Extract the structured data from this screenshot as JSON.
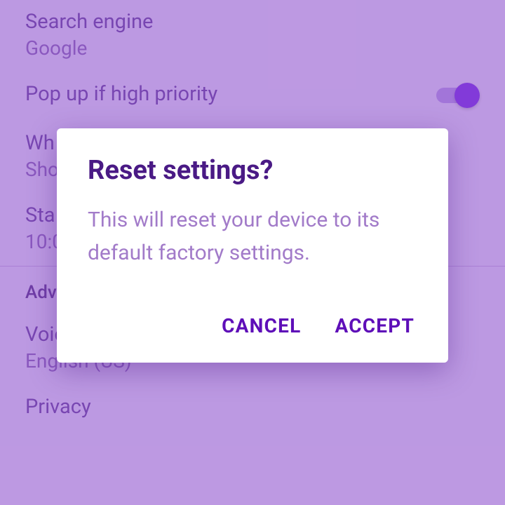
{
  "settings": {
    "search_engine": {
      "title": "Search engine",
      "value": "Google"
    },
    "pop_up": {
      "title": "Pop up if high priority",
      "enabled": true
    },
    "where": {
      "title": "Wh",
      "value": "Sho"
    },
    "start": {
      "title": "Sta",
      "value": "10:0"
    },
    "voice_search": {
      "title": "Voice search",
      "value": "English (US)"
    },
    "privacy": {
      "title": "Privacy"
    }
  },
  "section": {
    "advanced": "Adva"
  },
  "dialog": {
    "title": "Reset settings?",
    "body": "This will reset your device to its default factory settings.",
    "cancel": "CANCEL",
    "accept": "ACCEPT"
  }
}
